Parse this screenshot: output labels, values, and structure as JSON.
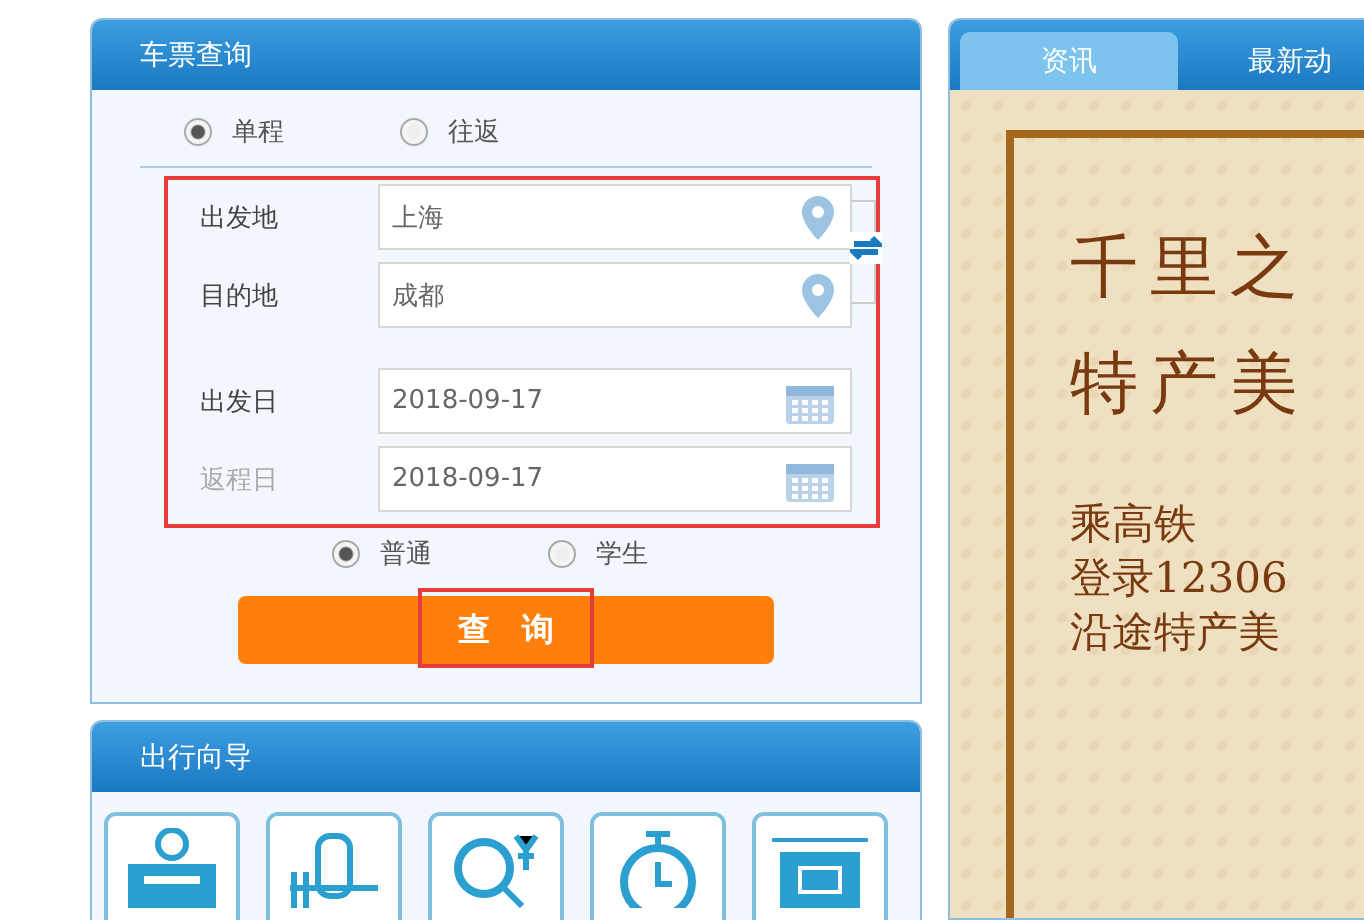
{
  "ticket_search": {
    "title": "车票查询",
    "trip_types": [
      {
        "label": "单程",
        "selected": true
      },
      {
        "label": "往返",
        "selected": false
      }
    ],
    "highlighted": true,
    "fields": [
      {
        "label": "出发地",
        "value": "上海",
        "kind": "place",
        "disabled": false
      },
      {
        "label": "目的地",
        "value": "成都",
        "kind": "place",
        "disabled": false
      },
      {
        "label": "出发日",
        "value": "2018-09-17",
        "kind": "date",
        "disabled": false
      },
      {
        "label": "返程日",
        "value": "2018-09-17",
        "kind": "date",
        "disabled": true
      }
    ],
    "passenger_types": [
      {
        "label": "普通",
        "selected": true
      },
      {
        "label": "学生",
        "selected": false
      }
    ],
    "search_button": {
      "label": "查　询",
      "highlighted": true
    }
  },
  "travel_guide": {
    "title": "出行向导",
    "tiles": [
      {
        "kind": "station"
      },
      {
        "kind": "train"
      },
      {
        "kind": "fare"
      },
      {
        "kind": "clock"
      },
      {
        "kind": "ticket"
      }
    ]
  },
  "news": {
    "tabs": [
      {
        "label": "资讯",
        "selected": true
      },
      {
        "label": "最新动",
        "selected": false
      }
    ],
    "banner": {
      "headline": [
        "千里之",
        "特产美"
      ],
      "lines": [
        "乘高铁",
        "登录12306",
        "沿途特产美"
      ]
    }
  }
}
